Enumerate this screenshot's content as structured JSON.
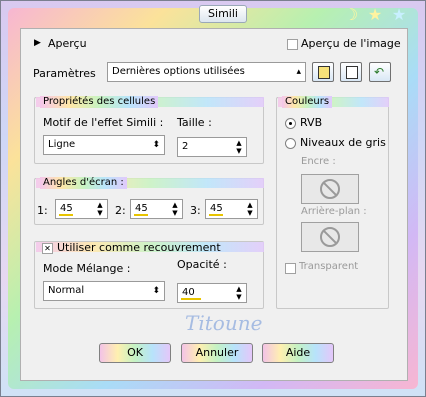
{
  "window": {
    "title": "Simili"
  },
  "preview": {
    "toggle_label": "Aperçu",
    "image_preview_label": "Aperçu de l'image"
  },
  "settings": {
    "label": "Paramètres",
    "preset_value": "Dernières options utilisées"
  },
  "cells": {
    "legend": "Propriétés des cellules",
    "pattern_label": "Motif de l'effet Simili :",
    "pattern_value": "Ligne",
    "size_label": "Taille :",
    "size_value": "2"
  },
  "angles": {
    "legend": "Angles d'écran :",
    "items": [
      {
        "label": "1:",
        "value": "45"
      },
      {
        "label": "2:",
        "value": "45"
      },
      {
        "label": "3:",
        "value": "45"
      }
    ]
  },
  "overlay": {
    "label": "Utiliser comme recouvrement",
    "blend_label": "Mode Mélange :",
    "blend_value": "Normal",
    "opacity_label": "Opacité :",
    "opacity_value": "40"
  },
  "colors": {
    "legend": "Couleurs",
    "rgb_label": "RVB",
    "gray_label": "Niveaux de gris",
    "ink_label": "Encre :",
    "background_label": "Arrière-plan :",
    "transparent_label": "Transparent"
  },
  "watermark": "Titoune",
  "buttons": {
    "ok": "OK",
    "cancel": "Annuler",
    "help": "Aide"
  }
}
